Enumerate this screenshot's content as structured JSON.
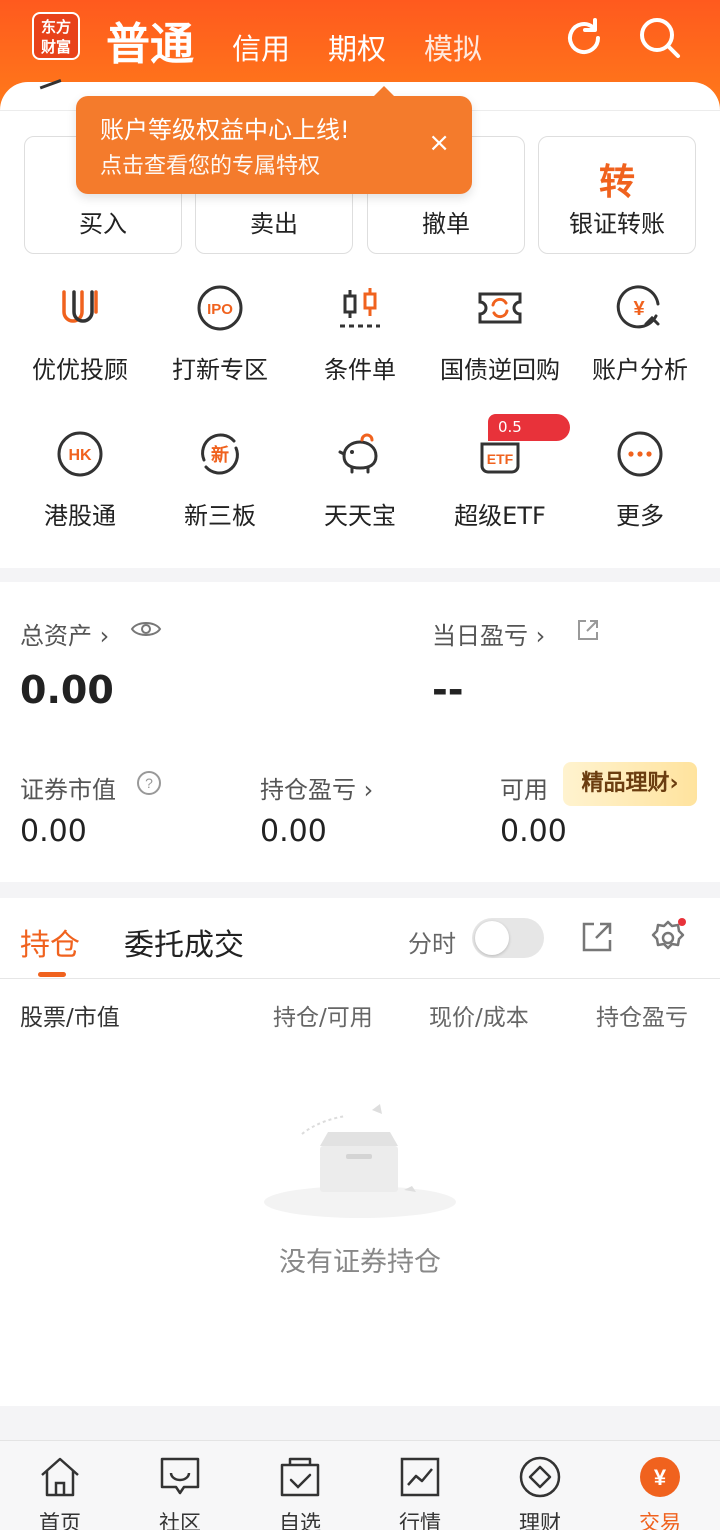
{
  "header": {
    "logo_text": "东方财富",
    "tabs": [
      {
        "label": "普通",
        "active": true
      },
      {
        "label": "信用"
      },
      {
        "label": "期权"
      },
      {
        "label": "模拟"
      }
    ],
    "icons": [
      "refresh-icon",
      "search-icon"
    ]
  },
  "tooltip": {
    "title": "账户等级权益中心上线!",
    "subtitle": "点击查看您的专属特权",
    "close": "×"
  },
  "quick_actions": [
    {
      "label": "买入"
    },
    {
      "label": "卖出"
    },
    {
      "label": "撤单"
    },
    {
      "label": "银证转账",
      "glyph": "转"
    }
  ],
  "grid": [
    {
      "label": "优优投顾",
      "icon": "youyou-icon"
    },
    {
      "label": "打新专区",
      "icon": "ipo-icon"
    },
    {
      "label": "条件单",
      "icon": "candlestick-icon"
    },
    {
      "label": "国债逆回购",
      "icon": "repo-ticket-icon"
    },
    {
      "label": "账户分析",
      "icon": "yen-analysis-icon"
    },
    {
      "label": "港股通",
      "icon": "hk-icon"
    },
    {
      "label": "新三板",
      "icon": "new-board-icon"
    },
    {
      "label": "天天宝",
      "icon": "piggy-bank-icon"
    },
    {
      "label": "超级ETF",
      "icon": "etf-icon",
      "badge": "0.5"
    },
    {
      "label": "更多",
      "icon": "more-icon"
    }
  ],
  "grid_text": {
    "ipo": "IPO",
    "hk": "HK",
    "xin": "新",
    "etf": "ETF",
    "yen": "¥"
  },
  "assets": {
    "total_label": "总资产",
    "total_value": "0.00",
    "daily_pl_label": "当日盈亏",
    "daily_pl_value": "--",
    "market_value_label": "证券市值",
    "market_value": "0.00",
    "position_pl_label": "持仓盈亏",
    "position_pl": "0.00",
    "available_label": "可用",
    "available": "0.00",
    "promo": "精品理财"
  },
  "holdings": {
    "tab_active": "持仓",
    "tab_other": "委托成交",
    "toggle_label": "分时",
    "toggle_on": false,
    "columns": [
      "股票/市值",
      "持仓/可用",
      "现价/成本",
      "持仓盈亏"
    ],
    "empty_text": "没有证券持仓"
  },
  "nav": [
    {
      "label": "首页",
      "icon": "home-icon"
    },
    {
      "label": "社区",
      "icon": "community-icon"
    },
    {
      "label": "自选",
      "icon": "watchlist-icon"
    },
    {
      "label": "行情",
      "icon": "market-icon"
    },
    {
      "label": "理财",
      "icon": "finance-icon"
    },
    {
      "label": "交易",
      "icon": "trade-icon",
      "active": true,
      "glyph": "¥"
    }
  ],
  "colors": {
    "brand": "#ff5a1e",
    "accent": "#f0621e",
    "badge": "#e8323a"
  }
}
